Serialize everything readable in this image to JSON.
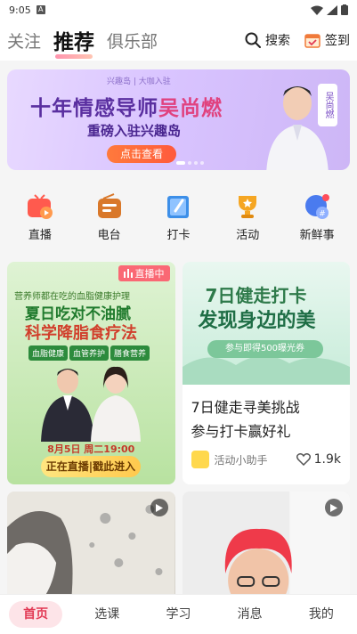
{
  "status_bar": {
    "time": "9:05",
    "notification_letter": "A"
  },
  "top_nav": {
    "tabs": [
      {
        "label": "关注"
      },
      {
        "label": "推荐"
      },
      {
        "label": "俱乐部"
      }
    ],
    "search_label": "搜索",
    "signin_label": "签到"
  },
  "banner": {
    "tag": "兴趣岛 | 大咖入驻",
    "title_prefix": "十年情感导师",
    "title_highlight": "吴尚燃",
    "subtitle": "重磅入驻兴趣岛",
    "button_label": "点击查看",
    "side_tag": "吴尚燃"
  },
  "quick_links": [
    {
      "label": "直播",
      "icon": "tv-icon",
      "color": "#ff5a4e"
    },
    {
      "label": "电台",
      "icon": "radio-icon",
      "color": "#d9782a"
    },
    {
      "label": "打卡",
      "icon": "notebook-icon",
      "color": "#3d8fe8"
    },
    {
      "label": "活动",
      "icon": "trophy-icon",
      "color": "#f5a623"
    },
    {
      "label": "新鲜事",
      "icon": "chat-bubble-icon",
      "color": "#4a7bef"
    }
  ],
  "feed": {
    "live_card": {
      "badge": "直播中",
      "caption": "营养师都在吃的血脂健康护理",
      "title_line1": "夏日吃对不油腻",
      "title_line2": "科学降脂食疗法",
      "pills": [
        "血脂健康",
        "血管养护",
        "膳食营养"
      ],
      "date": "8月5日 周二19:00",
      "button_label": "正在直播|戳此进入"
    },
    "walk_card": {
      "title_line1": "7日健走打卡",
      "title_line2": "发现身边的美",
      "coupon": "参与即得500曝光券",
      "text_line1": "7日健走寻美挑战",
      "text_line2": "参与打卡赢好礼",
      "author": "活动小助手",
      "likes": "1.9k"
    }
  },
  "bottom_nav": [
    {
      "label": "首页"
    },
    {
      "label": "选课"
    },
    {
      "label": "学习"
    },
    {
      "label": "消息"
    },
    {
      "label": "我的"
    }
  ]
}
